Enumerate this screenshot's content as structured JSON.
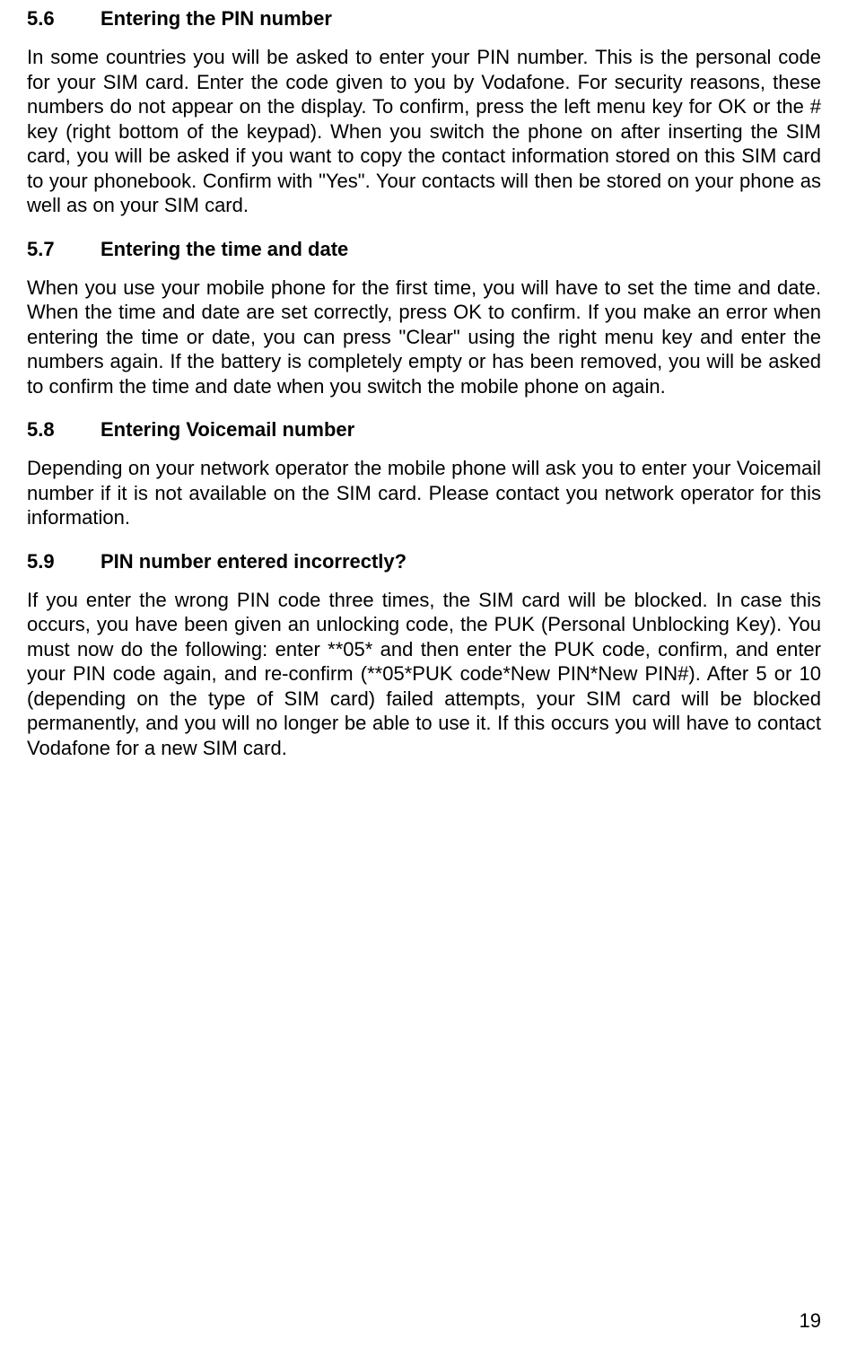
{
  "sections": [
    {
      "num": "5.6",
      "title": "Entering the PIN number",
      "body": "In some countries you will be asked to enter your PIN number. This is the personal code for your SIM card. Enter the code given to you by Vodafone. For security reasons, these numbers do not appear on the display. To confirm, press the left menu key for OK or the # key (right bottom of the keypad). When you switch the phone on after inserting the SIM card, you will be asked if you want to copy the contact information stored on this SIM card to your phonebook. Confirm with \"Yes\". Your contacts will then be stored on your phone as well as on your SIM card."
    },
    {
      "num": "5.7",
      "title": "Entering the time and date",
      "body": "When you use your mobile phone for the first time, you will have to set the time and date. When the time and date are set correctly, press OK to confirm. If you make an error when entering the time or date, you can press \"Clear\" using the right menu key and enter the numbers again. If the battery is completely empty or has been removed, you will be asked to confirm the time and date when you switch the mobile phone on again."
    },
    {
      "num": "5.8",
      "title": "Entering Voicemail number",
      "body": "Depending on your network operator the mobile phone will ask you to enter your Voicemail number if it is not available on the SIM card. Please contact you network operator for this information."
    },
    {
      "num": "5.9",
      "title": "PIN number entered incorrectly?",
      "body": "If you enter the wrong PIN code three times, the SIM card will be blocked. In case this occurs, you have been given an unlocking code, the PUK (Personal Unblocking Key). You must now do the following: enter **05* and then enter the PUK code, confirm, and enter your PIN code again, and re-confirm (**05*PUK code*New PIN*New PIN#). After 5 or 10 (depending on the type of SIM card) failed attempts, your SIM card will be blocked permanently, and you will no longer be able to use it. If this occurs you will have to contact Vodafone for a new SIM card."
    }
  ],
  "pageNumber": "19"
}
